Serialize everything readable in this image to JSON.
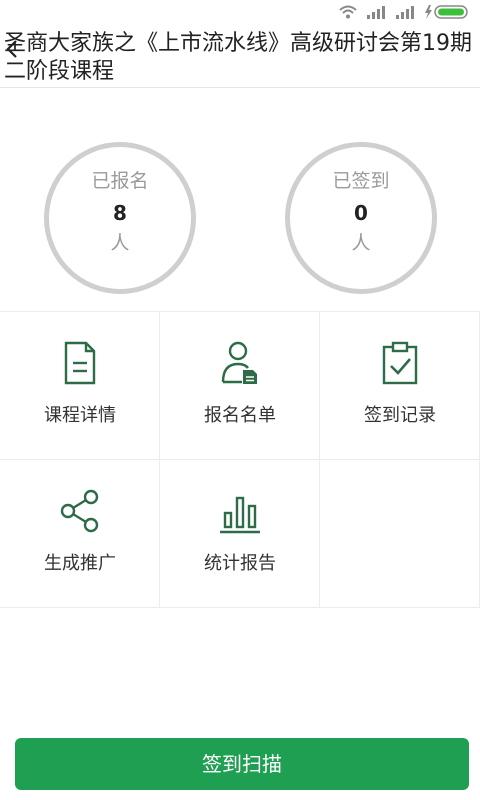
{
  "header": {
    "title": "圣商大家族之《上市流水线》高级研讨会第19期二阶段课程"
  },
  "stats": {
    "registered": {
      "label": "已报名",
      "count": "8",
      "unit": "人"
    },
    "checked_in": {
      "label": "已签到",
      "count": "0",
      "unit": "人"
    }
  },
  "menu": [
    {
      "label": "课程详情",
      "icon": "document-icon"
    },
    {
      "label": "报名名单",
      "icon": "user-list-icon"
    },
    {
      "label": "签到记录",
      "icon": "clipboard-check-icon"
    },
    {
      "label": "生成推广",
      "icon": "share-icon"
    },
    {
      "label": "统计报告",
      "icon": "bar-chart-icon"
    }
  ],
  "actions": {
    "scan_label": "签到扫描"
  },
  "colors": {
    "accent": "#1f9f52",
    "icon_green": "#2e6b47",
    "ring": "#cfcfcf"
  }
}
